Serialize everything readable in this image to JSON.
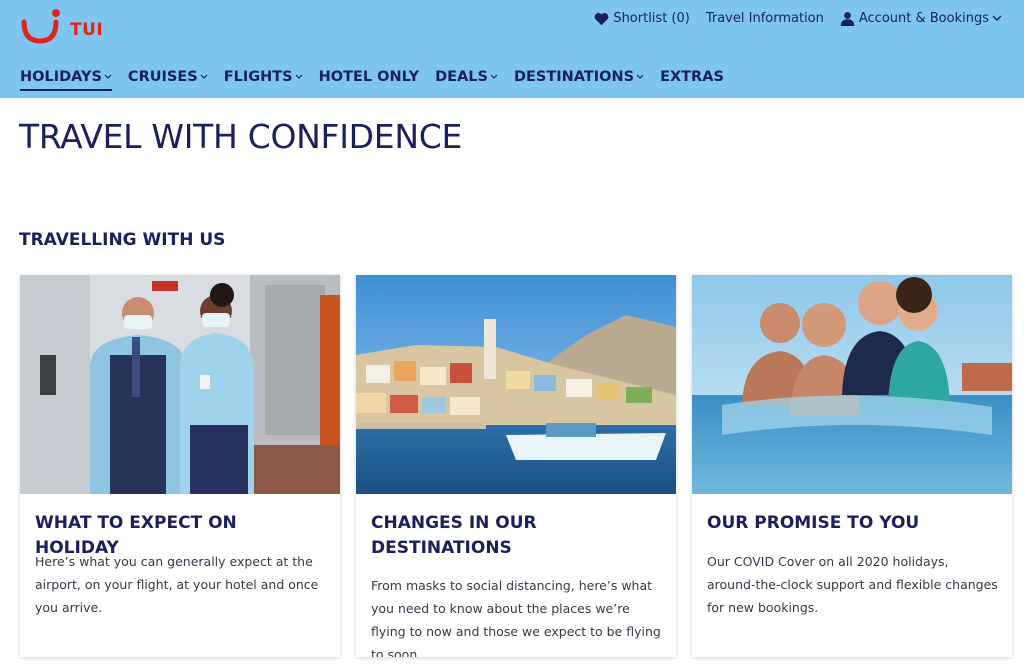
{
  "brand": {
    "logo_text": "TUI",
    "brand_color": "#e2231a",
    "header_color": "#7ec6f0",
    "navy": "#1a1f5e"
  },
  "utility_nav": {
    "shortlist": "Shortlist (0)",
    "travel_info": "Travel Information",
    "account": "Account & Bookings"
  },
  "main_nav": [
    {
      "label": "HOLIDAYS",
      "dropdown": true,
      "active": true
    },
    {
      "label": "CRUISES",
      "dropdown": true
    },
    {
      "label": "FLIGHTS",
      "dropdown": true
    },
    {
      "label": "HOTEL ONLY",
      "dropdown": false
    },
    {
      "label": "DEALS",
      "dropdown": true
    },
    {
      "label": "DESTINATIONS",
      "dropdown": true
    },
    {
      "label": "EXTRAS",
      "dropdown": false
    }
  ],
  "page": {
    "title": "TRAVEL WITH CONFIDENCE",
    "section_title": "TRAVELLING WITH US"
  },
  "cards": [
    {
      "title": "WHAT TO EXPECT ON HOLIDAY",
      "text": "Here’s what you can generally expect at the airport, on your flight, at your hotel and once you arrive."
    },
    {
      "title": "CHANGES IN OUR DESTINATIONS",
      "text": "From masks to social distancing, here’s what you need to know about the places we’re flying to now and those we expect to be flying to soon."
    },
    {
      "title": "OUR PROMISE TO YOU",
      "text": "Our COVID Cover on all 2020 holidays, around-the-clock support and flexible changes for new bookings."
    }
  ]
}
